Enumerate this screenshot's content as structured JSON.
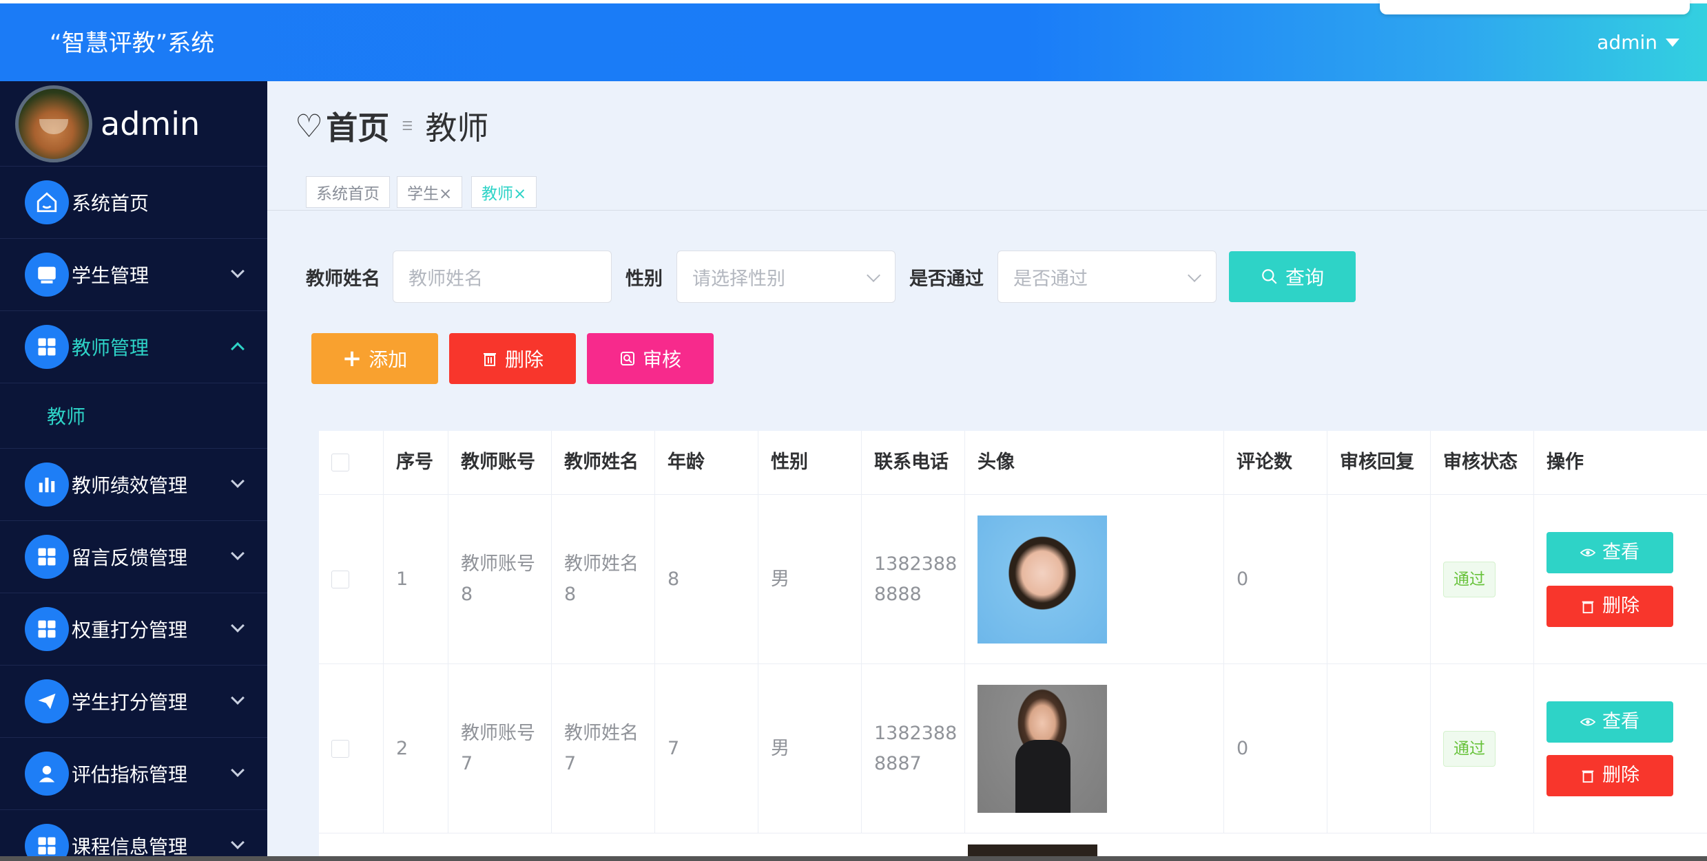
{
  "header": {
    "title": "“智慧评教”系统",
    "user": "admin"
  },
  "sidebar": {
    "username": "admin",
    "items": [
      {
        "label": "系统首页",
        "icon": "home-icon"
      },
      {
        "label": "学生管理",
        "icon": "student-icon"
      },
      {
        "label": "教师管理",
        "icon": "grid-icon"
      },
      {
        "label": "教师绩效管理",
        "icon": "bar-chart-icon"
      },
      {
        "label": "留言反馈管理",
        "icon": "grid-icon"
      },
      {
        "label": "权重打分管理",
        "icon": "grid-icon"
      },
      {
        "label": "学生打分管理",
        "icon": "send-icon"
      },
      {
        "label": "评估指标管理",
        "icon": "user-icon"
      },
      {
        "label": "课程信息管理",
        "icon": "grid-icon"
      }
    ],
    "sub_items": [
      {
        "label": "教师"
      }
    ]
  },
  "breadcrumb": {
    "home": "首页",
    "current": "教师"
  },
  "tabs": [
    {
      "label": "系统首页"
    },
    {
      "label": "学生×"
    },
    {
      "label": "教师×"
    }
  ],
  "search": {
    "name_label": "教师姓名",
    "name_placeholder": "教师姓名",
    "gender_label": "性别",
    "gender_placeholder": "请选择性别",
    "pass_label": "是否通过",
    "pass_placeholder": "是否通过",
    "query_button": "查询"
  },
  "actions": {
    "add": "添加",
    "delete": "删除",
    "audit": "审核"
  },
  "table": {
    "columns": [
      "序号",
      "教师账号",
      "教师姓名",
      "年龄",
      "性别",
      "联系电话",
      "头像",
      "评论数",
      "审核回复",
      "审核状态",
      "操作"
    ],
    "rows": [
      {
        "index": "1",
        "account_a": "教师账号",
        "account_b": "8",
        "name_a": "教师姓名",
        "name_b": "8",
        "age": "8",
        "gender": "男",
        "phone_a": "1382388",
        "phone_b": "8888",
        "comments": "0",
        "reply": "",
        "status": "通过",
        "view": "查看",
        "delete": "删除"
      },
      {
        "index": "2",
        "account_a": "教师账号",
        "account_b": "7",
        "name_a": "教师姓名",
        "name_b": "7",
        "age": "7",
        "gender": "男",
        "phone_a": "1382388",
        "phone_b": "8887",
        "comments": "0",
        "reply": "",
        "status": "通过",
        "view": "查看",
        "delete": "删除"
      }
    ]
  }
}
